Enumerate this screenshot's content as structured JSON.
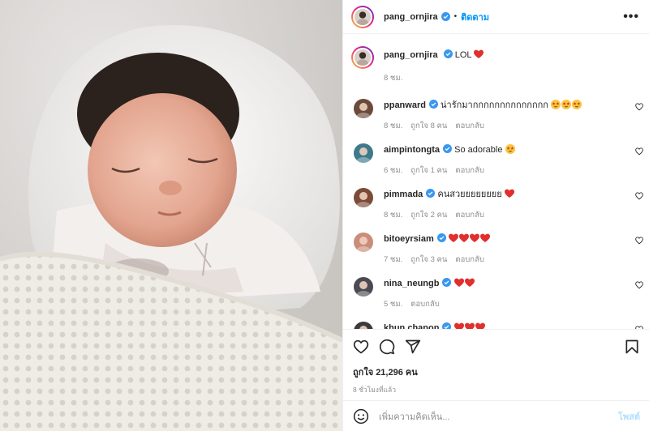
{
  "post": {
    "author": {
      "username": "pang_ornjira",
      "verified": true,
      "follow_label": "ติดตาม",
      "separator": "•",
      "more": "•••"
    },
    "caption": {
      "username": "pang_ornjira",
      "text": "LOL",
      "time": "8 ชม."
    },
    "comments": [
      {
        "username": "ppanward",
        "text": "น่ารักมากกกกกกกกกกกกกก",
        "emojis": [
          "star-eyes",
          "star-eyes",
          "star-eyes"
        ],
        "time": "8 ชม.",
        "likes": "ถูกใจ 8 คน",
        "reply": "ตอบกลับ",
        "avatar_color": "#6b4a3a"
      },
      {
        "username": "aimpintongta",
        "text": "So adorable",
        "emojis": [
          "star-eyes"
        ],
        "time": "6 ชม.",
        "likes": "ถูกใจ 1 คน",
        "reply": "ตอบกลับ",
        "avatar_color": "#3d7a8c"
      },
      {
        "username": "pimmada",
        "text": "คนสวยยยยยยยย",
        "emojis": [
          "red-heart"
        ],
        "time": "8 ชม.",
        "likes": "ถูกใจ 2 คน",
        "reply": "ตอบกลับ",
        "avatar_color": "#7a4b36"
      },
      {
        "username": "bitoeyrsiam",
        "text": "",
        "emojis": [
          "red-heart",
          "red-heart",
          "red-heart",
          "red-heart"
        ],
        "time": "7 ชม.",
        "likes": "ถูกใจ 3 คน",
        "reply": "ตอบกลับ",
        "avatar_color": "#c98d7a"
      },
      {
        "username": "nina_neungb",
        "text": "",
        "emojis": [
          "red-heart",
          "red-heart"
        ],
        "time": "5 ชม.",
        "likes": "",
        "reply": "ตอบกลับ",
        "avatar_color": "#4a4a52"
      },
      {
        "username": "khun.chanon",
        "text": "",
        "emojis": [
          "red-heart",
          "red-heart",
          "red-heart"
        ],
        "time": "",
        "likes": "",
        "reply": "",
        "avatar_color": "#3a3a3a"
      }
    ],
    "likes_label": "ถูกใจ 21,296 คน",
    "posted_ago": "8 ชั่วโมงที่แล้ว",
    "add_comment": {
      "placeholder": "เพิ่มความคิดเห็น...",
      "post_label": "โพสต์"
    },
    "icons": [
      "heart-icon",
      "comment-icon",
      "share-icon",
      "bookmark-icon",
      "smiley-icon",
      "verified-icon",
      "more-icon"
    ],
    "colors": {
      "link": "#0095f6",
      "muted": "#8e8e8e",
      "verified": "#3897f0",
      "heart": "#ed4956",
      "post_disabled": "#b2dffc"
    }
  }
}
